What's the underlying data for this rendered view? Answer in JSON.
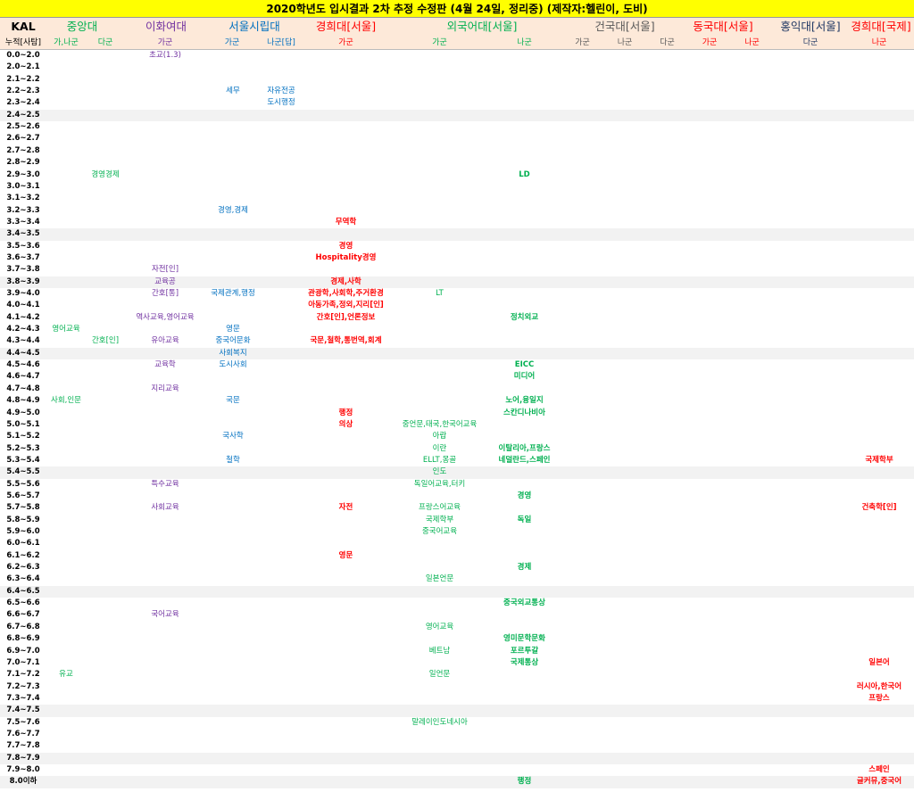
{
  "title": "2020학년도 입시결과 2차 추정 수정판 (4월 24일, 정리중) (제작자:헬린이, 도비)",
  "header": {
    "kal": "KAL",
    "cumulative": "누적[사탐]",
    "universities": [
      {
        "name": "중앙대",
        "color": "green"
      },
      {
        "name": "이화여대",
        "color": "purple"
      },
      {
        "name": "서울시립대",
        "color": "blue"
      },
      {
        "name": "경희대[서울]",
        "color": "red"
      },
      {
        "name": "외국어대[서울]",
        "color": "green"
      },
      {
        "name": "건국대[서울]",
        "color": "gray"
      },
      {
        "name": "동국대[서울]",
        "color": "red"
      },
      {
        "name": "홍익대[서울]",
        "color": "navy"
      },
      {
        "name": "경희대[국제]",
        "color": "red"
      }
    ],
    "columns": [
      {
        "label": "가,나군",
        "color": "green"
      },
      {
        "label": "다군",
        "color": "green"
      },
      {
        "label": "가군",
        "color": "purple"
      },
      {
        "label": "가군",
        "color": "blue"
      },
      {
        "label": "나군[답]",
        "color": "blue"
      },
      {
        "label": "가군",
        "color": "red"
      },
      {
        "label": "가군",
        "color": "green"
      },
      {
        "label": "나군",
        "color": "green"
      },
      {
        "label": "가군",
        "color": "gray"
      },
      {
        "label": "나군",
        "color": "gray"
      },
      {
        "label": "다군",
        "color": "gray"
      },
      {
        "label": "가군",
        "color": "red"
      },
      {
        "label": "나군",
        "color": "red"
      },
      {
        "label": "다군",
        "color": "navy"
      },
      {
        "label": "나군",
        "color": "red"
      }
    ]
  },
  "rows": [
    {
      "band": "0.0~2.0",
      "cells": {
        "2": "초교(1.3)"
      }
    },
    {
      "band": "2.0~2.1",
      "cells": {}
    },
    {
      "band": "2.1~2.2",
      "cells": {}
    },
    {
      "band": "2.2~2.3",
      "cells": {
        "3": "세무",
        "4": "자유전공"
      }
    },
    {
      "band": "2.3~2.4",
      "cells": {
        "4": "도시행정"
      }
    },
    {
      "band": "2.4~2.5",
      "cells": {}
    },
    {
      "band": "2.5~2.6",
      "cells": {}
    },
    {
      "band": "2.6~2.7",
      "cells": {}
    },
    {
      "band": "2.7~2.8",
      "cells": {}
    },
    {
      "band": "2.8~2.9",
      "cells": {}
    },
    {
      "band": "2.9~3.0",
      "cells": {
        "1": "경영경제",
        "7": "LD"
      }
    },
    {
      "band": "3.0~3.1",
      "cells": {}
    },
    {
      "band": "3.1~3.2",
      "cells": {}
    },
    {
      "band": "3.2~3.3",
      "cells": {
        "3": "경영,경제"
      }
    },
    {
      "band": "3.3~3.4",
      "cells": {
        "5": "무역학"
      }
    },
    {
      "band": "3.4~3.5",
      "cells": {}
    },
    {
      "band": "3.5~3.6",
      "cells": {
        "5": "경영"
      }
    },
    {
      "band": "3.6~3.7",
      "cells": {
        "5": "Hospitality경영"
      }
    },
    {
      "band": "3.7~3.8",
      "cells": {
        "2": "자전[인]"
      }
    },
    {
      "band": "3.8~3.9",
      "cells": {
        "2": "교육공",
        "5": "경제,사학"
      }
    },
    {
      "band": "3.9~4.0",
      "cells": {
        "2": "간호[통]",
        "3": "국제관계,행정",
        "5": "관광학,사회학,주거환경",
        "6": "LT"
      }
    },
    {
      "band": "4.0~4.1",
      "cells": {
        "5": "아동가족,정외,지리[인]"
      }
    },
    {
      "band": "4.1~4.2",
      "cells": {
        "2": "역사교육,영어교육",
        "5": "간호[인],언론정보",
        "7": "정치외교"
      }
    },
    {
      "band": "4.2~4.3",
      "cells": {
        "0": "영어교육",
        "3": "영문"
      }
    },
    {
      "band": "4.3~4.4",
      "cells": {
        "1": "간호[인]",
        "2": "유아교육",
        "3": "중국어문화",
        "5": "국문,철학,통번역,회계"
      }
    },
    {
      "band": "4.4~4.5",
      "cells": {
        "3": "사회복지"
      }
    },
    {
      "band": "4.5~4.6",
      "cells": {
        "2": "교육학",
        "3": "도시사회",
        "7": "EICC"
      }
    },
    {
      "band": "4.6~4.7",
      "cells": {
        "7": "미디어"
      }
    },
    {
      "band": "4.7~4.8",
      "cells": {
        "2": "지리교육"
      }
    },
    {
      "band": "4.8~4.9",
      "cells": {
        "0": "사회,인문",
        "3": "국문",
        "7": "노어,융일지"
      }
    },
    {
      "band": "4.9~5.0",
      "cells": {
        "5": "행정",
        "7": "스칸디나비아"
      }
    },
    {
      "band": "5.0~5.1",
      "cells": {
        "5": "의상",
        "6": "중언문,태국,한국어교육"
      }
    },
    {
      "band": "5.1~5.2",
      "cells": {
        "3": "국사학",
        "6": "아랍"
      }
    },
    {
      "band": "5.2~5.3",
      "cells": {
        "6": "이란",
        "7": "이탈리아,프랑스"
      }
    },
    {
      "band": "5.3~5.4",
      "cells": {
        "3": "철학",
        "6": "ELLT,몽골",
        "7": "네덜란드,스페인",
        "14": "국제학부"
      }
    },
    {
      "band": "5.4~5.5",
      "cells": {
        "6": "인도"
      }
    },
    {
      "band": "5.5~5.6",
      "cells": {
        "2": "특수교육",
        "6": "독일어교육,터키"
      }
    },
    {
      "band": "5.6~5.7",
      "cells": {
        "7": "경영"
      }
    },
    {
      "band": "5.7~5.8",
      "cells": {
        "2": "사회교육",
        "5": "자전",
        "6": "프랑스어교육",
        "14": "건축학[인]"
      }
    },
    {
      "band": "5.8~5.9",
      "cells": {
        "6": "국제학부",
        "7": "독일"
      }
    },
    {
      "band": "5.9~6.0",
      "cells": {
        "6": "중국어교육"
      }
    },
    {
      "band": "6.0~6.1",
      "cells": {}
    },
    {
      "band": "6.1~6.2",
      "cells": {
        "5": "영문"
      }
    },
    {
      "band": "6.2~6.3",
      "cells": {
        "7": "경제"
      }
    },
    {
      "band": "6.3~6.4",
      "cells": {
        "6": "일본언문"
      }
    },
    {
      "band": "6.4~6.5",
      "cells": {}
    },
    {
      "band": "6.5~6.6",
      "cells": {
        "7": "중국외교통상"
      }
    },
    {
      "band": "6.6~6.7",
      "cells": {
        "2": "국어교육"
      }
    },
    {
      "band": "6.7~6.8",
      "cells": {
        "6": "영어교육"
      }
    },
    {
      "band": "6.8~6.9",
      "cells": {
        "7": "영미문학문화"
      }
    },
    {
      "band": "6.9~7.0",
      "cells": {
        "6": "베트남",
        "7": "포르투갈"
      }
    },
    {
      "band": "7.0~7.1",
      "cells": {
        "7": "국제통상",
        "14": "일본어"
      }
    },
    {
      "band": "7.1~7.2",
      "cells": {
        "0": "유교",
        "6": "일언문"
      }
    },
    {
      "band": "7.2~7.3",
      "cells": {
        "14": "러시아,한국어"
      }
    },
    {
      "band": "7.3~7.4",
      "cells": {
        "14": "프랑스"
      }
    },
    {
      "band": "7.4~7.5",
      "cells": {}
    },
    {
      "band": "7.5~7.6",
      "cells": {
        "6": "말레이인도네시아"
      }
    },
    {
      "band": "7.6~7.7",
      "cells": {}
    },
    {
      "band": "7.7~7.8",
      "cells": {}
    },
    {
      "band": "7.8~7.9",
      "cells": {}
    },
    {
      "band": "7.9~8.0",
      "cells": {
        "14": "스페인"
      }
    },
    {
      "band": "8.0이하",
      "cells": {
        "7": "행정",
        "14": "글커뮤,중국어"
      }
    }
  ],
  "colors": {
    "green": "#00b050",
    "purple": "#7030a0",
    "blue": "#0070c0",
    "red": "#ff0000",
    "gray": "#595959",
    "navy": "#1f3864",
    "title_bg": "#ffff00",
    "header_bg": "#fde9d9",
    "stripe": "#f2f2f2"
  }
}
